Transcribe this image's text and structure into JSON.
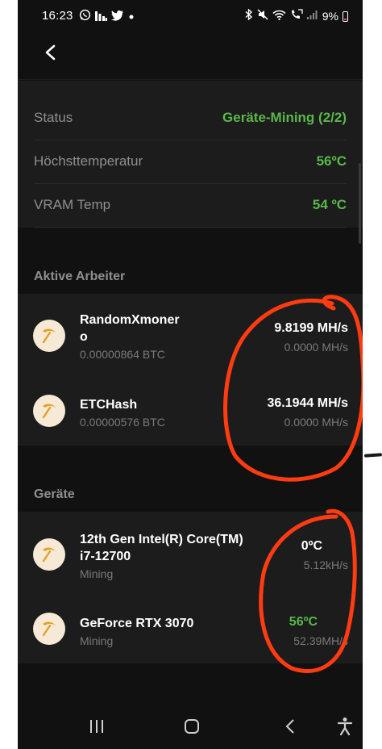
{
  "statusbar": {
    "time": "16:23",
    "battery_percent": "9%",
    "left_icons": [
      "whatsapp-icon",
      "stats-icon",
      "twitter-icon",
      "dot-icon"
    ],
    "right_icons": [
      "bluetooth-icon",
      "mute-icon",
      "wifi-icon",
      "call-icon",
      "signal-icon",
      "battery-icon"
    ]
  },
  "info": {
    "rows": [
      {
        "label": "Status",
        "value": "Geräte-Mining (2/2)"
      },
      {
        "label": "Höchsttemperatur",
        "value": "56ºC"
      },
      {
        "label": "VRAM Temp",
        "value": "54 ºC"
      }
    ]
  },
  "workers": {
    "title": "Aktive Arbeiter",
    "items": [
      {
        "name_line1": "RandomXmoner",
        "name_line2": "o",
        "sub": "0.00000864 BTC",
        "rate": "9.8199 MH/s",
        "rate_sub": "0.0000 MH/s"
      },
      {
        "name_line1": "ETCHash",
        "sub": "0.00000576 BTC",
        "rate": "36.1944 MH/s",
        "rate_sub": "0.0000 MH/s"
      }
    ]
  },
  "devices": {
    "title": "Geräte",
    "items": [
      {
        "name_line1": "12th Gen Intel(R) Core(TM)",
        "name_line2": "i7-12700",
        "sub": "Mining",
        "temp": "0ºC",
        "rate_sub": "5.12kH/s"
      },
      {
        "name_line1": "GeForce RTX 3070",
        "sub": "Mining",
        "temp": "56ºC",
        "rate_sub": "52.39MH/s"
      }
    ]
  },
  "colors": {
    "accent_green": "#59b84a",
    "annotation_red": "#ff3b12",
    "background": "#111111",
    "card": "#1c1c1c",
    "icon_bg": "#f6e9d6",
    "pickaxe": "#e3a02a"
  },
  "nav": [
    "recents-icon",
    "home-icon",
    "back-nav-icon",
    "accessibility-icon"
  ]
}
